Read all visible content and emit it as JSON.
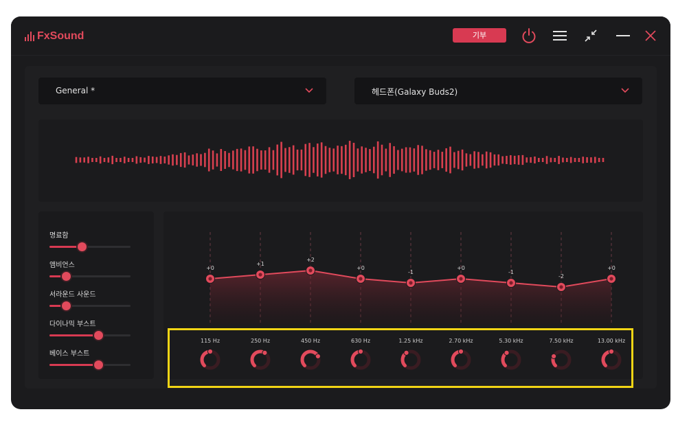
{
  "app": {
    "title": "FxSound"
  },
  "titlebar": {
    "donate_label": "기부",
    "icons": [
      "power-icon",
      "menu-icon",
      "minimize-to-tray-icon",
      "minimize-icon",
      "close-icon"
    ]
  },
  "preset": {
    "value": "General *"
  },
  "output": {
    "value": "헤드폰(Galaxy Buds2)"
  },
  "effects": [
    {
      "label": "명료함",
      "level": 0.4
    },
    {
      "label": "앰비언스",
      "level": 0.2
    },
    {
      "label": "서라운드 사운드",
      "level": 0.2
    },
    {
      "label": "다이나믹 부스트",
      "level": 0.6
    },
    {
      "label": "베이스 부스트",
      "level": 0.6
    }
  ],
  "eq": {
    "bands": [
      "115 Hz",
      "250 Hz",
      "450 Hz",
      "630 Hz",
      "1.25 kHz",
      "2.70 kHz",
      "5.30 kHz",
      "7.50 kHz",
      "13.00 kHz"
    ],
    "gains": [
      0,
      1,
      2,
      0,
      -1,
      0,
      -1,
      -2,
      0
    ],
    "gain_labels": [
      "+0",
      "+1",
      "+2",
      "+0",
      "-1",
      "+0",
      "-1",
      "-2",
      "+0"
    ]
  },
  "colors": {
    "accent": "#e24a5c",
    "background": "#1b1b1d",
    "panel": "#1f1f21",
    "highlight": "#f2d515"
  }
}
